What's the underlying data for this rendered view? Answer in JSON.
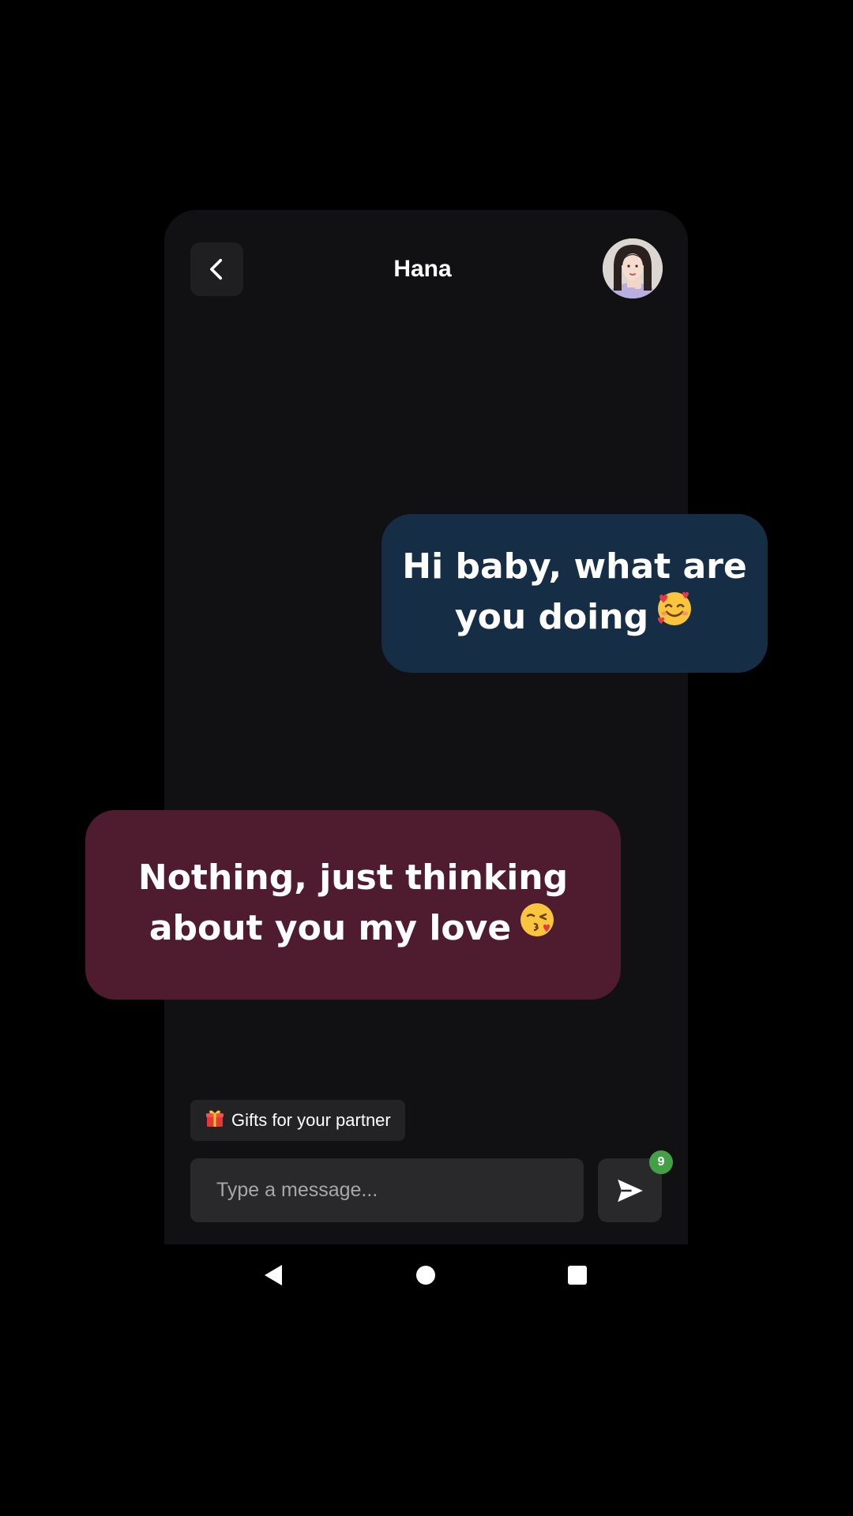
{
  "header": {
    "title": "Hana"
  },
  "messages": [
    {
      "direction": "outgoing",
      "text": "Hi baby, what are you doing",
      "emoji": "smiling-face-with-hearts"
    },
    {
      "direction": "incoming",
      "text": "Nothing, just thinking about you my love",
      "emoji": "face-blowing-kiss"
    }
  ],
  "composer": {
    "suggestion_chip": "Gifts for your partner",
    "placeholder": "Type a message...",
    "badge_count": "9"
  },
  "colors": {
    "background": "#000000",
    "screen": "#111113",
    "outgoing_bubble": "#162e45",
    "incoming_bubble": "#4e1c2e",
    "badge": "#43a047"
  },
  "icons": [
    "chevron-left-icon",
    "avatar",
    "gift-icon",
    "send-icon",
    "nav-back-icon",
    "nav-home-icon",
    "nav-recents-icon"
  ]
}
